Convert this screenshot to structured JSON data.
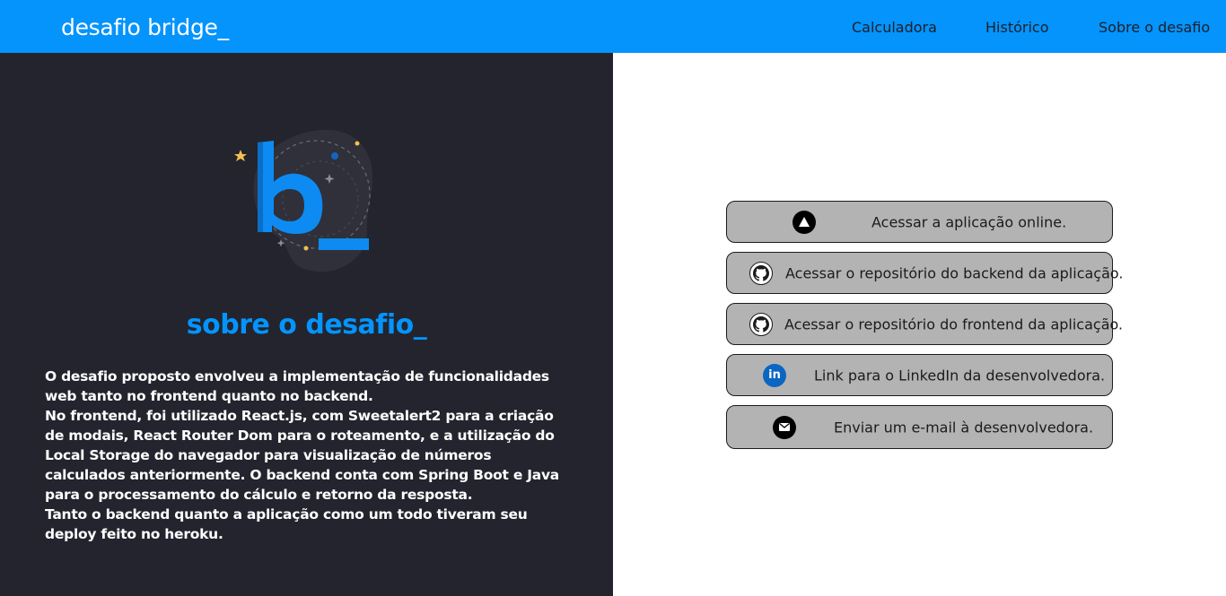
{
  "navbar": {
    "brand": "desafio bridge_",
    "links": [
      "Calculadora",
      "Histórico",
      "Sobre o desafio"
    ]
  },
  "about": {
    "logo_icon": "bridge-b-logo",
    "title": "sobre o desafio_",
    "paragraphs": [
      "O desafio proposto envolveu a implementação de funcionalidades web tanto no frontend quanto no backend.",
      "No frontend, foi utilizado React.js, com Sweetalert2 para a criação de modais, React Router Dom para o roteamento, e a utilização do Local Storage do navegador para visualização de números calculados anteriormente. O backend conta com Spring Boot e Java para o processamento do cálculo e retorno da resposta.",
      "Tanto o backend quanto a aplicação como um todo tiveram seu deploy feito no heroku."
    ]
  },
  "links": [
    {
      "icon": "vercel-triangle-icon",
      "label": "Acessar a aplicação online."
    },
    {
      "icon": "github-icon",
      "label": "Acessar o repositório do backend da aplicação."
    },
    {
      "icon": "github-icon",
      "label": "Acessar o repositório do frontend da aplicação."
    },
    {
      "icon": "linkedin-icon",
      "label": "Link para o LinkedIn da desenvolvedora."
    },
    {
      "icon": "email-icon",
      "label": "Enviar um e-mail à desenvolvedora."
    }
  ],
  "colors": {
    "accent": "#0494fc",
    "dark_panel": "#23242d",
    "button_bg": "#b3b3b3",
    "linkedin": "#0a66c2"
  }
}
